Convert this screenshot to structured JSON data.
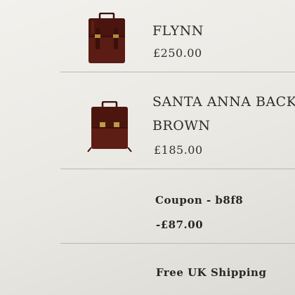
{
  "cart": {
    "items": [
      {
        "image_icon": "leather-backpack-image",
        "name": "FLYNN",
        "price": "£250.00"
      },
      {
        "image_icon": "leather-backpack-image",
        "name_line1": "SANTA ANNA BACK",
        "name_line2": "BROWN",
        "price": "£185.00"
      }
    ],
    "coupon": {
      "label": "Coupon - b8f8",
      "amount": "-£87.00"
    },
    "shipping": {
      "label": "Free UK Shipping"
    }
  },
  "colors": {
    "page_background": "#eceae6",
    "divider": "#b9b8b3",
    "text": "#2a2826",
    "leather": "#5a1c14"
  }
}
